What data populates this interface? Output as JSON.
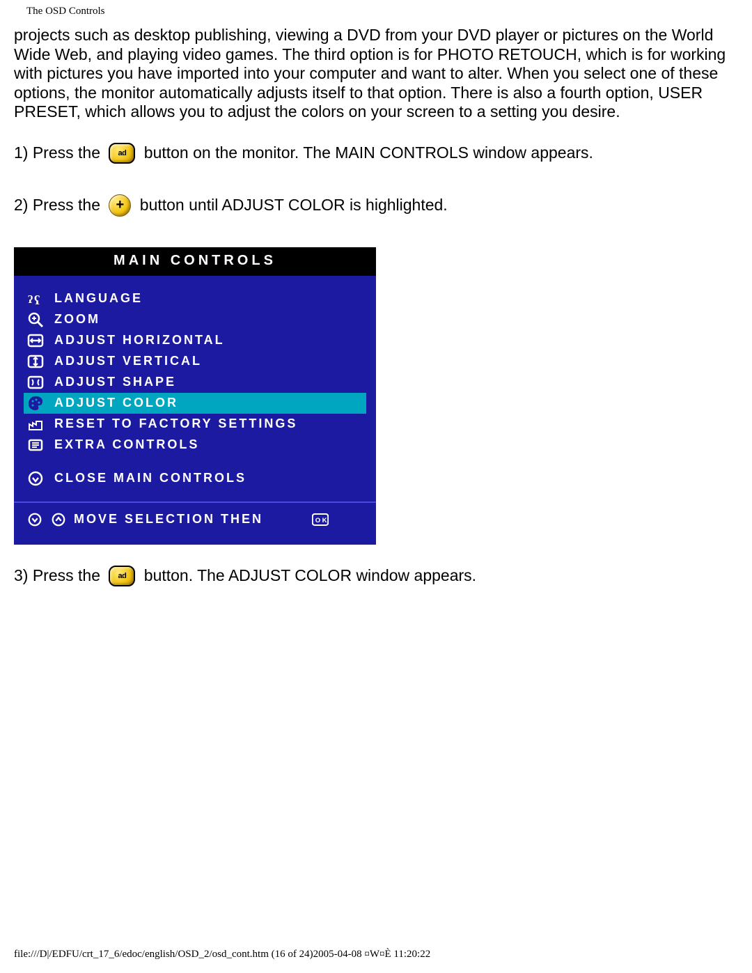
{
  "header_title": "The OSD Controls",
  "intro_paragraph": "projects such as desktop publishing, viewing a DVD from your DVD player or pictures on the World Wide Web, and playing video games. The third option is for PHOTO RETOUCH, which is for working with pictures you have imported into your computer and want to alter. When you select one of these options, the monitor automatically adjusts itself to that option. There is also a fourth option, USER PRESET, which allows you to adjust the colors on your screen to a setting you desire.",
  "step1_pre": "1) Press the ",
  "step1_post": " button on the monitor. The MAIN CONTROLS window appears.",
  "step2_pre": "2) Press the ",
  "step2_post": " button until ADJUST COLOR is highlighted.",
  "step3_pre": "3) Press the ",
  "step3_post": " button. The ADJUST COLOR window appears.",
  "ok_btn_label": "ad",
  "plus_btn_label": "+",
  "osd": {
    "title": "MAIN CONTROLS",
    "items": [
      {
        "label": "LANGUAGE",
        "selected": false,
        "icon": "language"
      },
      {
        "label": "ZOOM",
        "selected": false,
        "icon": "zoom"
      },
      {
        "label": "ADJUST HORIZONTAL",
        "selected": false,
        "icon": "horiz"
      },
      {
        "label": "ADJUST VERTICAL",
        "selected": false,
        "icon": "vert"
      },
      {
        "label": "ADJUST SHAPE",
        "selected": false,
        "icon": "shape"
      },
      {
        "label": "ADJUST COLOR",
        "selected": true,
        "icon": "color"
      },
      {
        "label": "RESET TO FACTORY SETTINGS",
        "selected": false,
        "icon": "reset"
      },
      {
        "label": "EXTRA CONTROLS",
        "selected": false,
        "icon": "extra"
      }
    ],
    "close_label": "CLOSE MAIN CONTROLS",
    "footer_label": "MOVE SELECTION THEN"
  },
  "page_footer": "file:///D|/EDFU/crt_17_6/edoc/english/OSD_2/osd_cont.htm (16 of 24)2005-04-08 ¤W¤È 11:20:22"
}
